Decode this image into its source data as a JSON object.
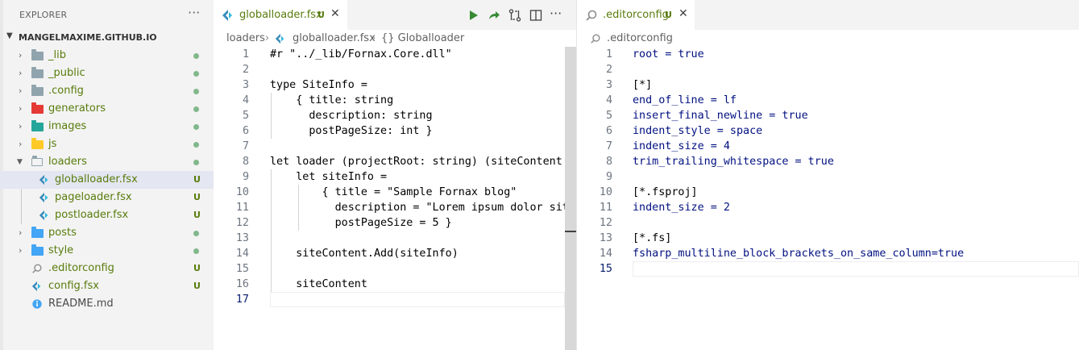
{
  "explorer": {
    "title": "EXPLORER",
    "more": "···",
    "root_label": "MANGELMAXIME.GITHUB.IO",
    "items": [
      {
        "label": "_lib",
        "badge": "dot"
      },
      {
        "label": "_public",
        "badge": "dot"
      },
      {
        "label": ".config",
        "badge": "dot"
      },
      {
        "label": "generators",
        "badge": "dot"
      },
      {
        "label": "images",
        "badge": "dot"
      },
      {
        "label": "js",
        "badge": "dot"
      },
      {
        "label": "loaders",
        "badge": "dot"
      },
      {
        "label": "globalloader.fsx",
        "badge": "U"
      },
      {
        "label": "pageloader.fsx",
        "badge": "U"
      },
      {
        "label": "postloader.fsx",
        "badge": "U"
      },
      {
        "label": "posts",
        "badge": "dot"
      },
      {
        "label": "style",
        "badge": "dot"
      },
      {
        "label": ".editorconfig",
        "badge": "U"
      },
      {
        "label": "config.fsx",
        "badge": "U"
      },
      {
        "label": "README.md",
        "badge": ""
      }
    ]
  },
  "editor_left": {
    "tab_label": "globalloader.fsx",
    "tab_badge": "U",
    "breadcrumb": [
      "loaders",
      "globalloader.fsx",
      "{} Globalloader"
    ],
    "line_numbers": [
      "1",
      "2",
      "3",
      "4",
      "5",
      "6",
      "7",
      "8",
      "9",
      "10",
      "11",
      "12",
      "13",
      "14",
      "15",
      "16",
      "17"
    ],
    "lines": [
      "#r \"../_lib/Fornax.Core.dll\"",
      "",
      "type SiteInfo =",
      "    { title: string",
      "      description: string",
      "      postPageSize: int }",
      "",
      "let loader (projectRoot: string) (siteContent",
      "    let siteInfo =",
      "        { title = \"Sample Fornax blog\"",
      "          description = \"Lorem ipsum dolor sit",
      "          postPageSize = 5 }",
      "",
      "    siteContent.Add(siteInfo)",
      "",
      "    siteContent",
      ""
    ]
  },
  "editor_right": {
    "tab_label": ".editorconfig",
    "tab_badge": "U",
    "breadcrumb": [
      ".editorconfig"
    ],
    "line_numbers": [
      "1",
      "2",
      "3",
      "4",
      "5",
      "6",
      "7",
      "8",
      "9",
      "10",
      "11",
      "12",
      "13",
      "14",
      "15"
    ],
    "lines": [
      "root = true",
      "",
      "[*]",
      "end_of_line = lf",
      "insert_final_newline = true",
      "indent_style = space",
      "indent_size = 4",
      "trim_trailing_whitespace = true",
      "",
      "[*.fsproj]",
      "indent_size = 2",
      "",
      "[*.fs]",
      "fsharp_multiline_block_brackets_on_same_column=true",
      ""
    ]
  },
  "colors": {
    "untracked_green": "#587c0c",
    "keyword_blue": "#0000ff",
    "type_teal": "#267f99",
    "string_red": "#a31515",
    "run_green": "#388a34"
  }
}
